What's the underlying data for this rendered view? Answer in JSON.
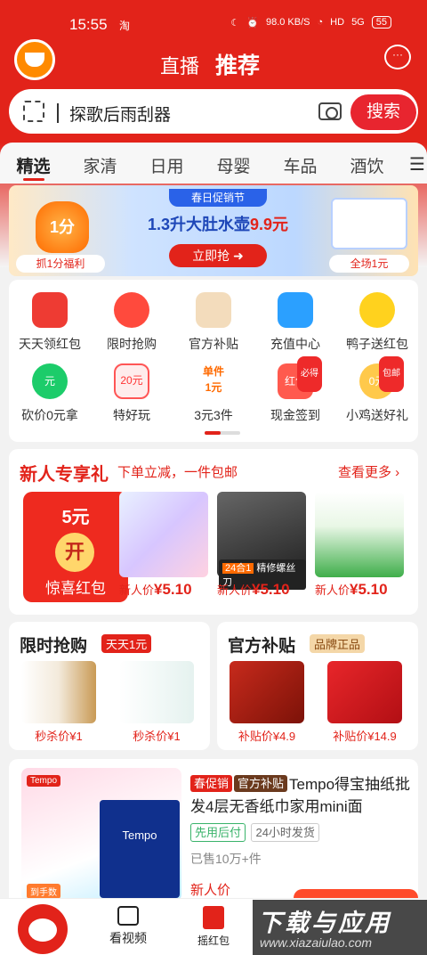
{
  "status": {
    "time": "15:55",
    "app_glyph": "淘",
    "net": "98.0\nKB/S",
    "net_label": "98.0 KB/S",
    "hd": "HD",
    "signal": "5G",
    "battery": "55"
  },
  "header": {
    "tab_live": "直播",
    "tab_recommend": "推荐"
  },
  "search": {
    "query": "探歌后雨刮器",
    "button": "搜索"
  },
  "categories": [
    "精选",
    "家清",
    "日用",
    "母婴",
    "车品",
    "酒饮"
  ],
  "banner": {
    "left_amount": "1分",
    "left_label": "抓1分福利",
    "event": "春日促销节",
    "title_pre": "1.3升大肚水壶",
    "title_price": "9.9元",
    "cta": "立即抢",
    "right_label": "全场1元"
  },
  "grid": [
    {
      "label": "天天领红包",
      "icon": "red-envelope-icon"
    },
    {
      "label": "限时抢购",
      "icon": "alarm-clock-icon"
    },
    {
      "label": "官方补贴",
      "icon": "coupon-icon"
    },
    {
      "label": "充值中心",
      "icon": "phone-charge-icon"
    },
    {
      "label": "鸭子送红包",
      "icon": "duck-icon"
    },
    {
      "label": "砍价0元拿",
      "icon": "zero-yuan-icon",
      "mark": "元"
    },
    {
      "label": "特好玩",
      "icon": "twenty-yuan-icon",
      "mark": "20元"
    },
    {
      "label": "3元3件",
      "icon": "single-one-yuan-icon",
      "mark": "单件\n1元"
    },
    {
      "label": "现金签到",
      "icon": "cash-redpacket-icon",
      "mark": "红包",
      "badge": "必得"
    },
    {
      "label": "小鸡送好礼",
      "icon": "chick-icon",
      "mark": "0元",
      "badge": "包邮"
    }
  ],
  "newuser": {
    "title": "新人专享礼",
    "subtitle": "下单立减，一件包邮",
    "more": "查看更多",
    "red_amount": "5元",
    "red_open": "开",
    "red_label": "惊喜红包",
    "price_prefix": "新人价",
    "products": [
      {
        "price": "¥5.10"
      },
      {
        "price": "¥5.10",
        "sticker_tag": "24合1",
        "sticker": "精修螺丝刀"
      },
      {
        "price": "¥5.10"
      }
    ]
  },
  "flash": {
    "title": "限时抢购",
    "badge": "天天1元",
    "items": [
      {
        "price": "秒杀价¥1"
      },
      {
        "price": "秒杀价¥1"
      }
    ]
  },
  "subsidy": {
    "title": "官方补贴",
    "badge": "品牌正品",
    "items": [
      {
        "price": "补贴价¥4.9"
      },
      {
        "price": "补贴价¥14.9"
      }
    ]
  },
  "product": {
    "chip1": "春促销",
    "chip2": "官方补贴",
    "title": "Tempo得宝抽纸批发4层无香纸巾家用mini面",
    "tag1": "先用后付",
    "tag2": "24小时发货",
    "sold": "已售10万+件",
    "price_label": "新人价",
    "brand": "Tempo",
    "pack_text": "Tempo",
    "img_tag": "到手数"
  },
  "bottom_nav": {
    "video": "看视频",
    "redpacket": "摇红包"
  },
  "watermark": {
    "title": "下载与应用",
    "url": "www.xiazaiulao.com"
  },
  "colors": {
    "brand_red": "#e2231a",
    "price_red": "#e2231a",
    "accent_orange": "#ff6a00"
  }
}
